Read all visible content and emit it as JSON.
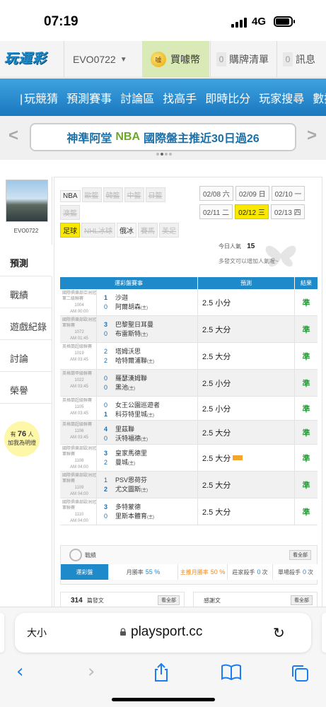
{
  "statusbar": {
    "time": "07:19",
    "network": "4G"
  },
  "header": {
    "logo": "玩運彩",
    "username": "EVO0722",
    "coin_label": "買噱幣",
    "coin_icon_text": "噱",
    "orders_count": "0",
    "orders_label": "購牌清單",
    "messages_count": "0",
    "messages_label": "訊息"
  },
  "nav": [
    "玩競猜",
    "預測賽事",
    "討論區",
    "找高手",
    "即時比分",
    "玩家搜尋",
    "數據"
  ],
  "banner": {
    "prefix": "神準阿堂",
    "highlight": "NBA",
    "suffix": "國際盤主推近30日過26"
  },
  "sidebar": {
    "username": "EVO0722",
    "menu": [
      "預測",
      "戰績",
      "遊戲紀錄",
      "討論",
      "榮譽"
    ],
    "fans_prefix": "有",
    "fans_count": "76",
    "fans_unit": "人",
    "fans_suffix": "加我為明燈"
  },
  "league_tags": [
    {
      "label": "NBA",
      "state": "on"
    },
    {
      "label": "歐籃",
      "state": "off"
    },
    {
      "label": "韓籃",
      "state": "off"
    },
    {
      "label": "中籃",
      "state": "off"
    },
    {
      "label": "日籃",
      "state": "off"
    },
    {
      "label": "澳籃",
      "state": "off"
    },
    {
      "label": "足球",
      "state": "selected"
    },
    {
      "label": "NHL冰球",
      "state": "off"
    },
    {
      "label": "俄冰",
      "state": "on"
    },
    {
      "label": "賽馬",
      "state": "off"
    },
    {
      "label": "美足",
      "state": "off"
    }
  ],
  "dates": [
    {
      "label": "02/08 六",
      "selected": false
    },
    {
      "label": "02/09 日",
      "selected": false
    },
    {
      "label": "02/10 一",
      "selected": false
    },
    {
      "label": "02/11 二",
      "selected": false
    },
    {
      "label": "02/12 三",
      "selected": true
    },
    {
      "label": "02/13 四",
      "selected": false
    }
  ],
  "popularity": {
    "label": "今日人氣",
    "value": "15",
    "note": "多發文可以增加人氣喔~"
  },
  "table": {
    "headers": [
      "運彩盤賽事",
      "預測",
      "結果"
    ],
    "rows": [
      {
        "league": "國際俱樂部亞洲冠軍二級聯賽",
        "code": "1004",
        "time": "AM 00:00",
        "away": "沙迦",
        "away_score": "1",
        "home": "阿爾胡森",
        "home_score": "0",
        "pick": "2.5 小分",
        "hot": false,
        "result": "準"
      },
      {
        "league": "國際俱樂部歐洲冠軍聯賽",
        "code": "1072",
        "time": "AM 01:45",
        "away": "巴黎聖日耳曼",
        "away_score": "3",
        "home": "布雷斯特",
        "home_score": "0",
        "pick": "2.5 大分",
        "hot": false,
        "result": "準"
      },
      {
        "league": "英格蘭超級聯賽",
        "code": "1019",
        "time": "AM 03:45",
        "away": "塔姆沃思",
        "away_score": "2",
        "home": "哈特爾浦聯",
        "home_score": "2",
        "pick": "2.5 大分",
        "hot": false,
        "result": "準"
      },
      {
        "league": "英格蘭甲級聯賽",
        "code": "1022",
        "time": "AM 03:45",
        "away": "羅瑟漢姆聯",
        "away_score": "0",
        "home": "黑池",
        "home_score": "0",
        "pick": "2.5 小分",
        "hot": false,
        "result": "準"
      },
      {
        "league": "英格蘭超級聯賽",
        "code": "1105",
        "time": "AM 03:45",
        "away": "女王公園巡遊者",
        "away_score": "0",
        "home": "科芬特里城",
        "home_score": "1",
        "pick": "2.5 小分",
        "hot": false,
        "result": "準"
      },
      {
        "league": "英格蘭超級聯賽",
        "code": "1106",
        "time": "AM 03:45",
        "away": "里茲聯",
        "away_score": "4",
        "home": "沃特福德",
        "home_score": "0",
        "pick": "2.5 大分",
        "hot": false,
        "result": "準"
      },
      {
        "league": "國際俱樂部歐洲冠軍聯賽",
        "code": "1108",
        "time": "AM 04:00",
        "away": "皇家馬德里",
        "away_score": "3",
        "home": "曼城",
        "home_score": "2",
        "pick": "2.5 大分",
        "hot": true,
        "result": "準"
      },
      {
        "league": "國際俱樂部歐洲冠軍聯賽",
        "code": "1109",
        "time": "AM 04:00",
        "away": "PSV恩荷芬",
        "away_score": "1",
        "home": "尤文圖斯",
        "home_score": "2",
        "pick": "2.5 大分",
        "hot": false,
        "result": "準"
      },
      {
        "league": "國際俱樂部歐洲冠軍聯賽",
        "code": "1110",
        "time": "AM 04:00",
        "away": "多特蒙德",
        "away_score": "3",
        "home": "里斯本體育",
        "home_score": "0",
        "pick": "2.5 大分",
        "hot": false,
        "result": "準"
      }
    ]
  },
  "record": {
    "title": "戰績",
    "all_label": "看全部",
    "tab_main": "運彩盤",
    "stat1_label": "月勝率",
    "stat1_value": "55 %",
    "stat2_label": "主推月勝率",
    "stat2_value": "50 %",
    "stat3_label": "莊家殺手",
    "stat3_value": "0",
    "stat3_unit": "次",
    "stat4_label": "單場殺手",
    "stat4_value": "0",
    "stat4_unit": "次"
  },
  "cards": [
    {
      "count": "314",
      "label": "篇發文",
      "all": "看全部"
    },
    {
      "count": "",
      "label": "感謝文",
      "all": "看全部"
    }
  ],
  "safari": {
    "text_size": "大小",
    "url": "playsport.cc"
  },
  "colors": {
    "brand_blue": "#1f8ac9",
    "win_green": "#2a9a3a",
    "highlight_yellow": "#f9e900"
  }
}
